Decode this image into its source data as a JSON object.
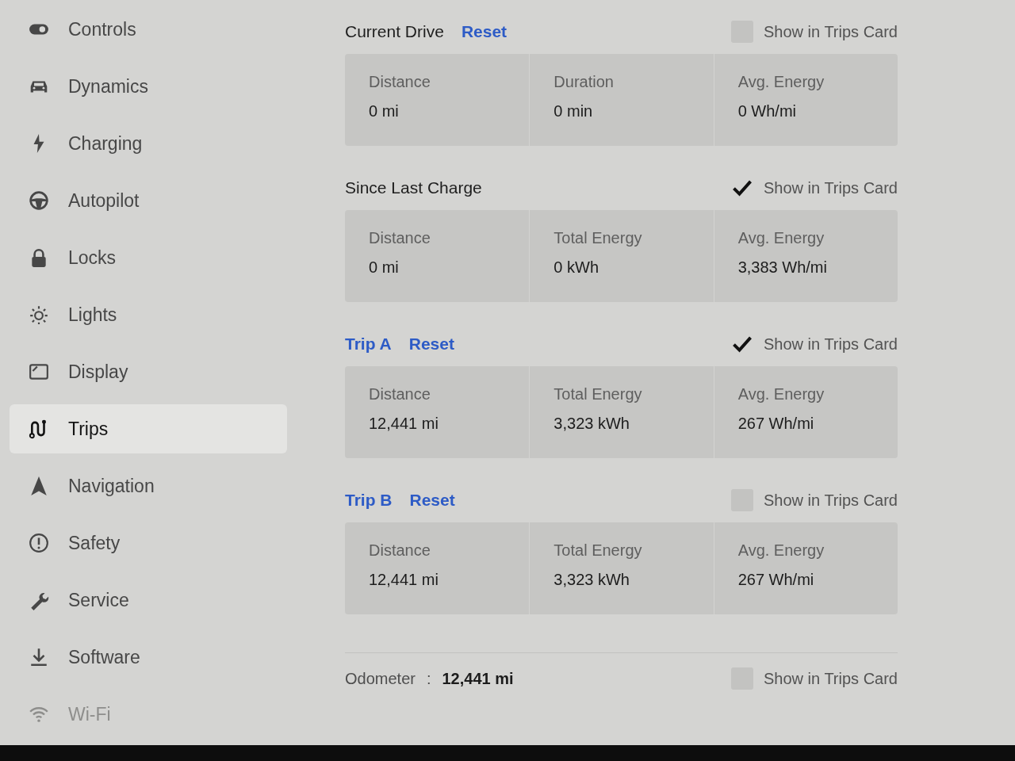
{
  "sidebar": {
    "items": [
      {
        "label": "Controls",
        "selected": false
      },
      {
        "label": "Dynamics",
        "selected": false
      },
      {
        "label": "Charging",
        "selected": false
      },
      {
        "label": "Autopilot",
        "selected": false
      },
      {
        "label": "Locks",
        "selected": false
      },
      {
        "label": "Lights",
        "selected": false
      },
      {
        "label": "Display",
        "selected": false
      },
      {
        "label": "Trips",
        "selected": true
      },
      {
        "label": "Navigation",
        "selected": false
      },
      {
        "label": "Safety",
        "selected": false
      },
      {
        "label": "Service",
        "selected": false
      },
      {
        "label": "Software",
        "selected": false
      },
      {
        "label": "Wi-Fi",
        "selected": false
      }
    ]
  },
  "sections": [
    {
      "title": "Current Drive",
      "title_is_link": false,
      "reset": "Reset",
      "show_in_trips_card": {
        "label": "Show in Trips Card",
        "checked": false
      },
      "stats": [
        {
          "label": "Distance",
          "value": "0 mi"
        },
        {
          "label": "Duration",
          "value": "0 min"
        },
        {
          "label": "Avg. Energy",
          "value": "0 Wh/mi"
        }
      ]
    },
    {
      "title": "Since Last Charge",
      "title_is_link": false,
      "show_in_trips_card": {
        "label": "Show in Trips Card",
        "checked": true
      },
      "stats": [
        {
          "label": "Distance",
          "value": "0 mi"
        },
        {
          "label": "Total Energy",
          "value": "0 kWh"
        },
        {
          "label": "Avg. Energy",
          "value": "3,383 Wh/mi"
        }
      ]
    },
    {
      "title": "Trip A",
      "title_is_link": true,
      "reset": "Reset",
      "show_in_trips_card": {
        "label": "Show in Trips Card",
        "checked": true
      },
      "stats": [
        {
          "label": "Distance",
          "value": "12,441 mi"
        },
        {
          "label": "Total Energy",
          "value": "3,323 kWh"
        },
        {
          "label": "Avg. Energy",
          "value": "267 Wh/mi"
        }
      ]
    },
    {
      "title": "Trip B",
      "title_is_link": true,
      "reset": "Reset",
      "show_in_trips_card": {
        "label": "Show in Trips Card",
        "checked": false
      },
      "stats": [
        {
          "label": "Distance",
          "value": "12,441 mi"
        },
        {
          "label": "Total Energy",
          "value": "3,323 kWh"
        },
        {
          "label": "Avg. Energy",
          "value": "267 Wh/mi"
        }
      ]
    }
  ],
  "odometer": {
    "label": "Odometer",
    "separator": ":",
    "value": "12,441 mi",
    "show_in_trips_card": {
      "label": "Show in Trips Card",
      "checked": false
    }
  }
}
